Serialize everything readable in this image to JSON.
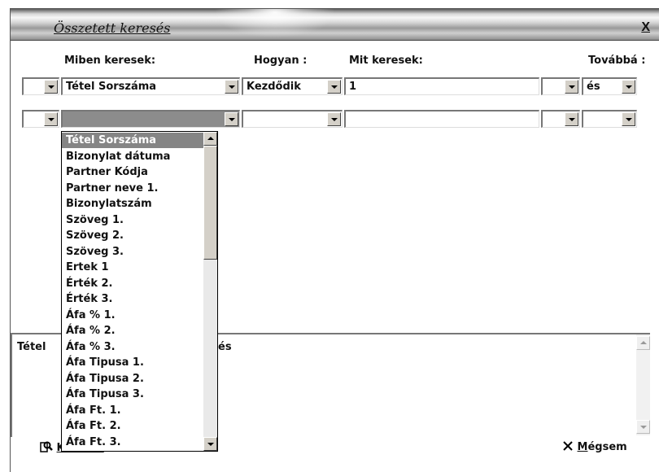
{
  "window": {
    "title": "Összetett keresés",
    "close_label": "X"
  },
  "headers": {
    "miben": "Miben keresek:",
    "hogyan": "Hogyan :",
    "mit": "Mit keresek:",
    "tovabba": "Továbbá :"
  },
  "rows": [
    {
      "field": "Tétel Sorszáma",
      "how": "Kezdődik",
      "value": "1",
      "next": "és"
    },
    {
      "field": "",
      "how": "",
      "value": "",
      "next": ""
    }
  ],
  "dropdown": {
    "selected_index": 0,
    "items": [
      "Tétel Sorszáma",
      "Bizonylat dátuma",
      "Partner Kódja",
      "Partner neve 1.",
      "Bizonylatszám",
      "Szöveg 1.",
      "Szöveg 2.",
      "Szöveg 3.",
      "Ertek 1",
      "Érték 2.",
      "Érték 3.",
      "Áfa % 1.",
      "Áfa % 2.",
      "Áfa % 3.",
      "Áfa Tipusa 1.",
      "Áfa Tipusa 2.",
      "Áfa Tipusa 3.",
      "Áfa Ft. 1.",
      "Áfa Ft. 2.",
      "Áfa Ft. 3."
    ]
  },
  "summary": {
    "left": "Tétel",
    "right": "és"
  },
  "buttons": {
    "search_label": "Keresés",
    "cancel_first": "M",
    "cancel_rest": "égsem"
  },
  "icons": {
    "search": "search-icon",
    "cancel": "close-icon"
  }
}
